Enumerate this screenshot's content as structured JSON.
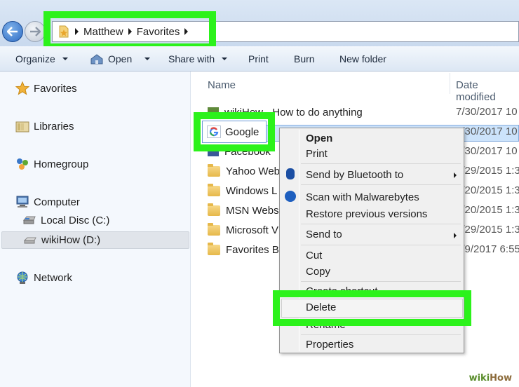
{
  "address_bar": {
    "crumbs": [
      "Matthew",
      "Favorites"
    ]
  },
  "toolbar": {
    "organize": "Organize",
    "open": "Open",
    "share_with": "Share with",
    "print": "Print",
    "burn": "Burn",
    "new_folder": "New folder"
  },
  "sidebar": {
    "favorites": "Favorites",
    "libraries": "Libraries",
    "homegroup": "Homegroup",
    "computer": "Computer",
    "local_disc": "Local Disc (C:)",
    "wikihow_drive": "wikiHow (D:)",
    "network": "Network"
  },
  "columns": {
    "name": "Name",
    "date_modified": "Date modified"
  },
  "files": [
    {
      "name": "wikiHow - How to do anything",
      "date": "7/30/2017 10"
    },
    {
      "name": "Google",
      "date": "7/30/2017 10"
    },
    {
      "name": "Facebook",
      "date": "7/30/2017 10"
    },
    {
      "name": "Yahoo Web",
      "date": "5/29/2015 1:3"
    },
    {
      "name": "Windows L",
      "date": "5/20/2015 1:3"
    },
    {
      "name": "MSN Webs",
      "date": "5/20/2015 1:3"
    },
    {
      "name": "Microsoft V",
      "date": "5/29/2015 1:3"
    },
    {
      "name": "Favorites B",
      "date": "5/9/2017 6:55"
    }
  ],
  "context_menu": {
    "open": "Open",
    "print": "Print",
    "send_bluetooth": "Send by Bluetooth to",
    "scan_malwarebytes": "Scan with Malwarebytes",
    "restore_versions": "Restore previous versions",
    "send_to": "Send to",
    "cut": "Cut",
    "copy": "Copy",
    "create_shortcut": "Create shortcut",
    "delete": "Delete",
    "rename": "Rename",
    "properties": "Properties"
  },
  "watermark": {
    "part1": "wiki",
    "part2": "How"
  },
  "colors": {
    "highlight": "#2cf21b",
    "selection": "#cce3fb",
    "toolbar": "#dce7f4"
  }
}
